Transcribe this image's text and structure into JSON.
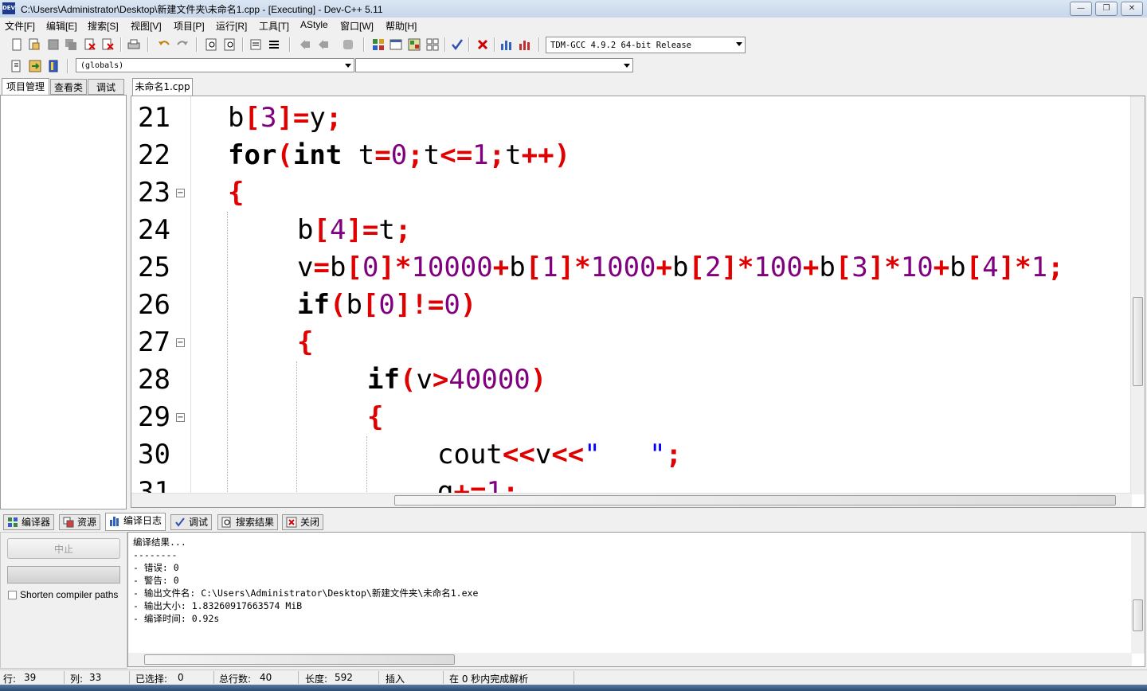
{
  "window": {
    "title": "C:\\Users\\Administrator\\Desktop\\新建文件夹\\未命名1.cpp - [Executing] - Dev-C++ 5.11",
    "icon_text": "DEV",
    "minimize_glyph": "—",
    "restore_glyph": "❐",
    "close_glyph": "✕"
  },
  "menu": [
    "文件[F]",
    "编辑[E]",
    "搜索[S]",
    "视图[V]",
    "项目[P]",
    "运行[R]",
    "工具[T]",
    "AStyle",
    "窗口[W]",
    "帮助[H]"
  ],
  "toolbar": {
    "compiler_select": "TDM-GCC 4.9.2 64-bit Release",
    "scope_select": "(globals)",
    "member_select": ""
  },
  "left_tabs": [
    "项目管理",
    "查看类",
    "调试"
  ],
  "editor": {
    "file_tab": "未命名1.cpp",
    "line_numbers": [
      "21",
      "22",
      "23",
      "24",
      "25",
      "26",
      "27",
      "28",
      "29",
      "30",
      "31"
    ]
  },
  "bottom_tabs": [
    "编译器",
    "资源",
    "编译日志",
    "调试",
    "搜索结果",
    "关闭"
  ],
  "compile_panel": {
    "abort_button": "中止",
    "shorten_paths_label": "Shorten compiler paths",
    "log": [
      "编译结果...",
      "--------",
      "- 错误: 0",
      "- 警告: 0",
      "- 输出文件名: C:\\Users\\Administrator\\Desktop\\新建文件夹\\未命名1.exe",
      "- 输出大小: 1.83260917663574 MiB",
      "- 编译时间: 0.92s"
    ]
  },
  "statusbar": {
    "row_label": "行:",
    "row_value": "39",
    "col_label": "列:",
    "col_value": "33",
    "sel_label": "已选择:",
    "sel_value": "0",
    "lines_label": "总行数:",
    "lines_value": "40",
    "len_label": "长度:",
    "len_value": "592",
    "mode": "插入",
    "parse_msg": "在 0 秒内完成解析"
  },
  "colors": {
    "keyword": "#000000",
    "operator": "#e00000",
    "number": "#800080",
    "string": "#0000ff"
  }
}
